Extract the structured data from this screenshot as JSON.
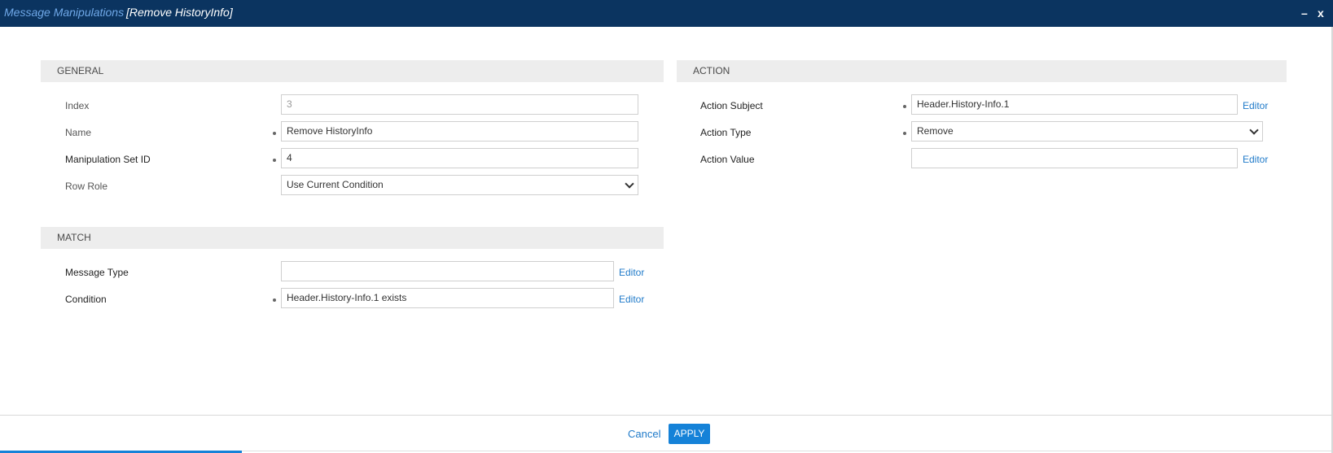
{
  "window": {
    "app_title": "Message Manipulations",
    "record_title": "[Remove HistoryInfo]",
    "minimize_symbol": "–",
    "close_symbol": "x"
  },
  "general": {
    "heading": "GENERAL",
    "index_label": "Index",
    "index_value": "3",
    "name_label": "Name",
    "name_value": "Remove HistoryInfo",
    "set_id_label": "Manipulation Set ID",
    "set_id_value": "4",
    "row_role_label": "Row Role",
    "row_role_value": "Use Current Condition"
  },
  "match": {
    "heading": "MATCH",
    "message_type_label": "Message Type",
    "message_type_value": "",
    "condition_label": "Condition",
    "condition_value": "Header.History-Info.1 exists",
    "editor_label": "Editor"
  },
  "action": {
    "heading": "ACTION",
    "subject_label": "Action Subject",
    "subject_value": "Header.History-Info.1",
    "type_label": "Action Type",
    "type_value": "Remove",
    "value_label": "Action Value",
    "value_value": "",
    "editor_label": "Editor"
  },
  "footer": {
    "cancel_label": "Cancel",
    "apply_label": "APPLY"
  },
  "icons": {
    "minimize": "minimize-icon",
    "close": "close-icon",
    "dropdown": "chevron-down-icon"
  },
  "colors": {
    "titlebar": "#0b3460",
    "accent": "#1582d8",
    "link": "#1f7ac9"
  }
}
